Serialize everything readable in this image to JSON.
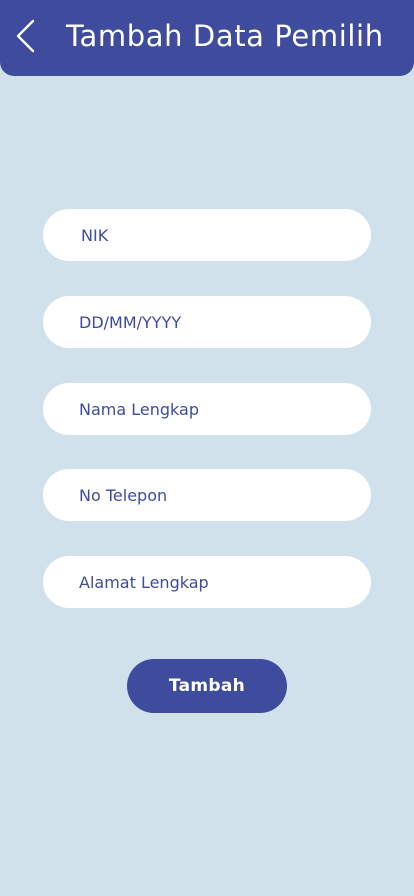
{
  "header": {
    "title": "Tambah Data Pemilih",
    "back_icon": "chevron-left-icon"
  },
  "form": {
    "fields": [
      {
        "placeholder": "NIK",
        "value": ""
      },
      {
        "placeholder": "DD/MM/YYYY",
        "value": ""
      },
      {
        "placeholder": "Nama Lengkap",
        "value": ""
      },
      {
        "placeholder": "No Telepon",
        "value": ""
      },
      {
        "placeholder": "Alamat Lengkap",
        "value": ""
      }
    ],
    "submit_label": "Tambah"
  },
  "colors": {
    "background": "#d1e1ec",
    "primary": "#3f4c9e",
    "field_background": "#ffffff",
    "text_on_primary": "#ffffff"
  }
}
